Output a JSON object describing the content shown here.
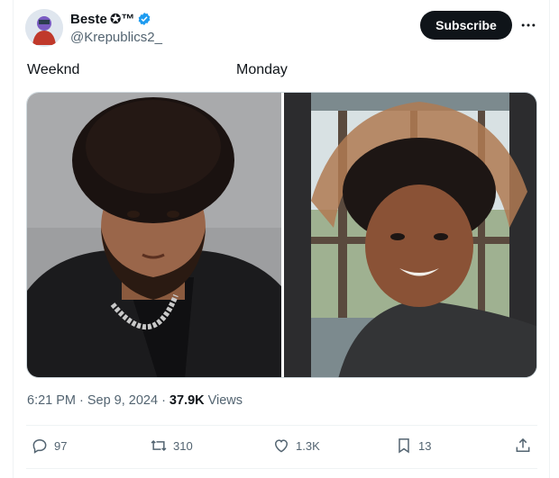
{
  "author": {
    "display_name": "Beste",
    "name_emoji": "✪™",
    "handle": "@Krepublics2_"
  },
  "buttons": {
    "subscribe_label": "Subscribe"
  },
  "post": {
    "caption_left": "Weeknd",
    "caption_right": "Monday",
    "time": "6:21 PM",
    "separator": "·",
    "date": "Sep 9, 2024",
    "views_count": "37.9K",
    "views_label": "Views"
  },
  "actions": {
    "replies": "97",
    "reposts": "310",
    "likes": "1.3K",
    "bookmarks": "13"
  },
  "colors": {
    "verified": "#1d9bf0",
    "text_secondary": "#536471",
    "button_dark": "#0f1419"
  },
  "icons": [
    "verified-icon",
    "more-icon",
    "reply-icon",
    "repost-icon",
    "like-icon",
    "bookmark-icon",
    "share-icon"
  ]
}
